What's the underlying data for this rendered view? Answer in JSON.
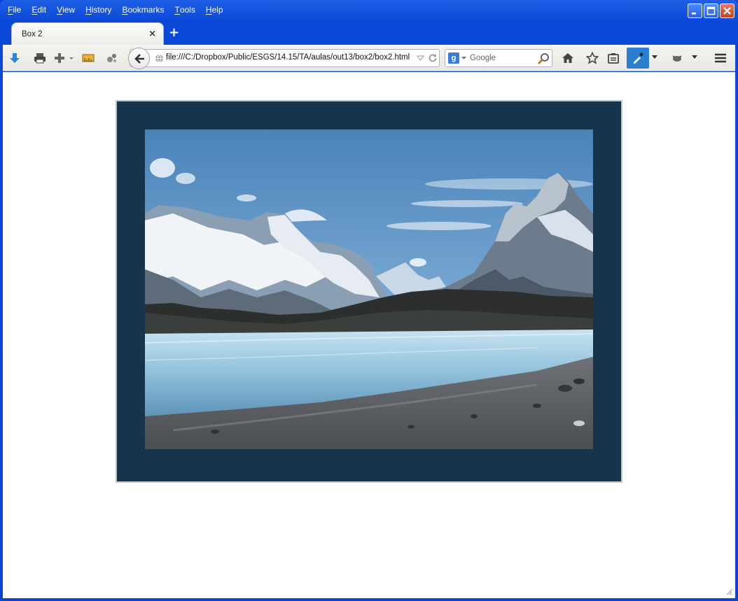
{
  "menu": [
    {
      "key": "F",
      "rest": "ile"
    },
    {
      "key": "E",
      "rest": "dit"
    },
    {
      "key": "V",
      "rest": "iew"
    },
    {
      "key": "H",
      "rest": "istory"
    },
    {
      "key": "B",
      "rest": "ookmarks"
    },
    {
      "key": "T",
      "rest": "ools"
    },
    {
      "key": "H",
      "rest": "elp"
    }
  ],
  "tab": {
    "title": "Box 2",
    "close": "×"
  },
  "newtab": "+",
  "url": "file:///C:/Dropbox/Public/ESGS/14.15/TA/aulas/out13/box2/box2.html",
  "search": {
    "engine": "g",
    "placeholder": "Google"
  },
  "colors": {
    "box_background": "#17344d",
    "box_border": "#b9c6d3",
    "page_background": "#ffffff"
  },
  "icons": [
    "downloads-icon",
    "print-icon",
    "add-icon",
    "ruler-icon",
    "network-icon",
    "back-icon",
    "globe-icon",
    "dropdown-icon",
    "reload-icon",
    "search-icon",
    "home-icon",
    "bookmark-star-icon",
    "reader-icon",
    "pipette-icon",
    "extension-icon",
    "menu-icon"
  ]
}
